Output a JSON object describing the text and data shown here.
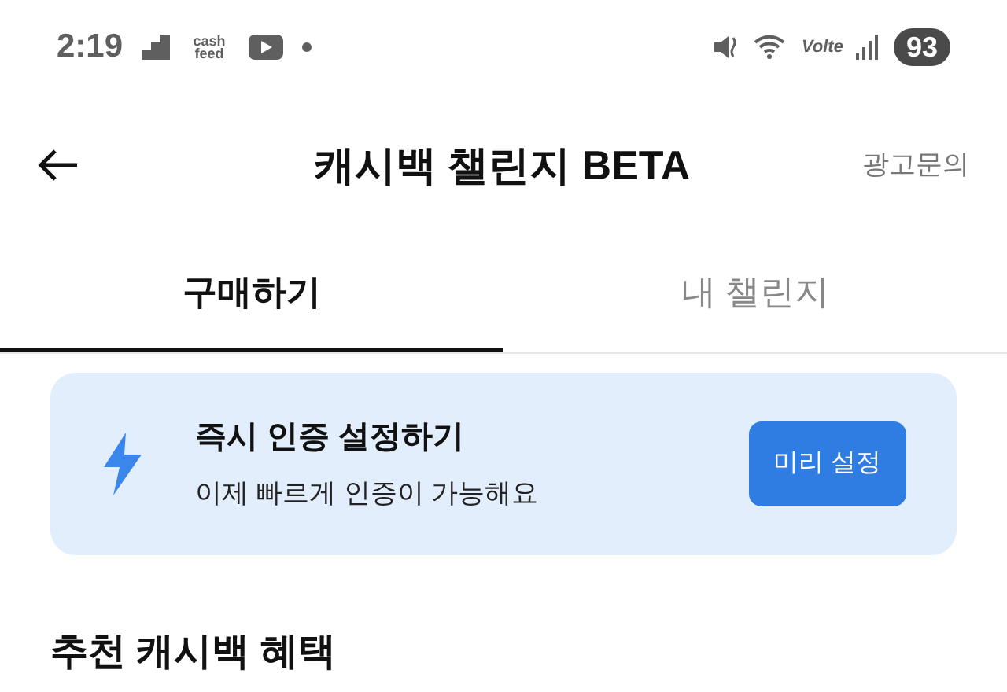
{
  "status_bar": {
    "time": "2:19",
    "app_logo": "cash feed",
    "network": "Volte",
    "battery": "93"
  },
  "header": {
    "title": "캐시백 챌린지 BETA",
    "action": "광고문의"
  },
  "tabs": [
    {
      "label": "구매하기",
      "selected": true
    },
    {
      "label": "내 챌린지",
      "selected": false
    }
  ],
  "banner": {
    "title": "즉시 인증 설정하기",
    "subtitle": "이제 빠르게 인증이 가능해요",
    "button": "미리 설정"
  },
  "section_title": "추천 캐시백 혜택"
}
